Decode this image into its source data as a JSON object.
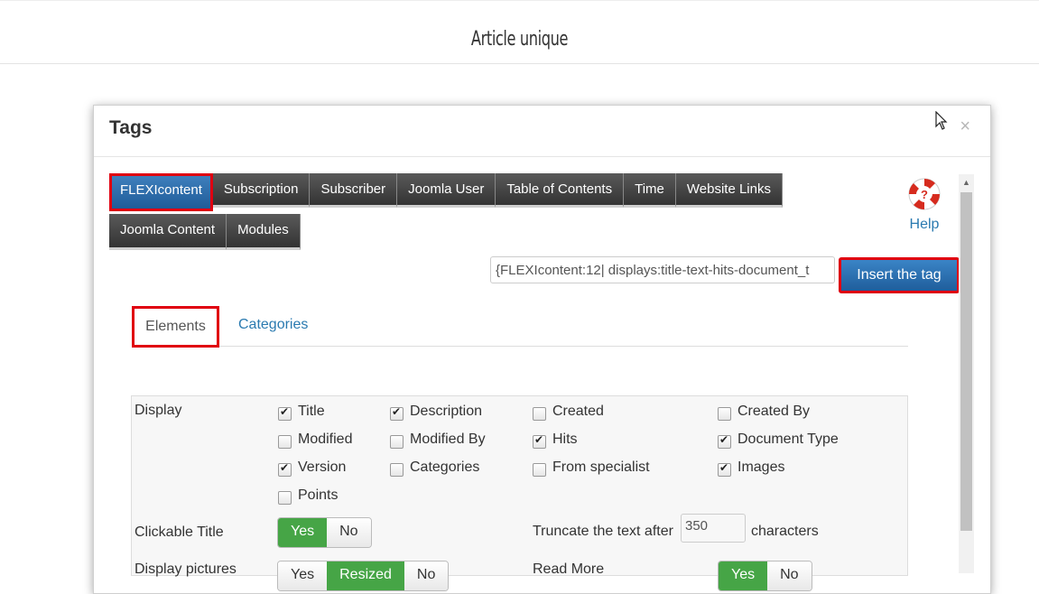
{
  "page": {
    "title": "Article unique"
  },
  "modal": {
    "title": "Tags",
    "close": "×",
    "tabs_row1": [
      "FLEXIcontent",
      "Subscription",
      "Subscriber",
      "Joomla User",
      "Table of Contents",
      "Time",
      "Website Links"
    ],
    "tabs_row2": [
      "Joomla Content",
      "Modules"
    ],
    "help_label": "Help",
    "tag_value": "{FLEXIcontent:12| displays:title-text-hits-document_t",
    "insert_label": "Insert the tag",
    "subtabs": {
      "elements": "Elements",
      "categories": "Categories"
    },
    "display": {
      "label": "Display",
      "options": [
        {
          "label": "Title",
          "checked": true
        },
        {
          "label": "Description",
          "checked": true
        },
        {
          "label": "Created",
          "checked": false
        },
        {
          "label": "Created By",
          "checked": false
        },
        {
          "label": "Modified",
          "checked": false
        },
        {
          "label": "Modified By",
          "checked": false
        },
        {
          "label": "Hits",
          "checked": true
        },
        {
          "label": "Document Type",
          "checked": true
        },
        {
          "label": "Version",
          "checked": true
        },
        {
          "label": "Categories",
          "checked": false
        },
        {
          "label": "From specialist",
          "checked": false
        },
        {
          "label": "Images",
          "checked": true
        },
        {
          "label": "Points",
          "checked": false
        }
      ]
    },
    "clickable_title": {
      "label": "Clickable Title",
      "yes": "Yes",
      "no": "No",
      "value": "Yes"
    },
    "truncate": {
      "label": "Truncate the text after",
      "value": "350",
      "suffix": "characters"
    },
    "display_pictures": {
      "label": "Display pictures",
      "opt1": "Yes",
      "opt2": "Resized",
      "opt3": "No",
      "value": "Resized"
    },
    "read_more": {
      "label": "Read More",
      "yes": "Yes",
      "no": "No",
      "value": "Yes"
    }
  },
  "colors": {
    "accent_blue": "#1f5e9c",
    "highlight_red": "#e00010",
    "toggle_green": "#46a546",
    "link": "#2a7ab0"
  }
}
